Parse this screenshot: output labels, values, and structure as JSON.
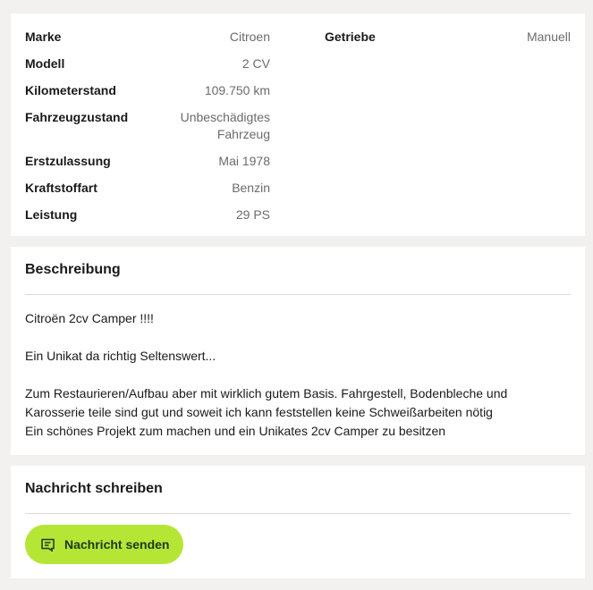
{
  "details": {
    "left": [
      {
        "key": "Marke",
        "value": "Citroen"
      },
      {
        "key": "Modell",
        "value": "2 CV"
      },
      {
        "key": "Kilometerstand",
        "value": "109.750 km"
      },
      {
        "key": "Fahrzeugzustand",
        "value": "Unbeschädigtes Fahrzeug"
      },
      {
        "key": "Erstzulassung",
        "value": "Mai 1978"
      },
      {
        "key": "Kraftstoffart",
        "value": "Benzin"
      },
      {
        "key": "Leistung",
        "value": "29 PS"
      }
    ],
    "right": [
      {
        "key": "Getriebe",
        "value": "Manuell"
      }
    ]
  },
  "description": {
    "title": "Beschreibung",
    "lines": [
      "Citroën 2cv Camper !!!!",
      "Ein Unikat da richtig Seltenswert...",
      "Zum Restaurieren/Aufbau aber mit wirklich gutem Basis. Fahrgestell, Bodenbleche und",
      "Karosserie teile sind gut und soweit ich kann feststellen keine Schweißarbeiten nötig",
      "Ein schönes Projekt zum machen und ein Unikates 2cv Camper zu besitzen"
    ]
  },
  "message": {
    "title": "Nachricht schreiben",
    "button_label": "Nachricht senden",
    "button_icon": "chat-icon",
    "button_color": "#b5e636"
  }
}
